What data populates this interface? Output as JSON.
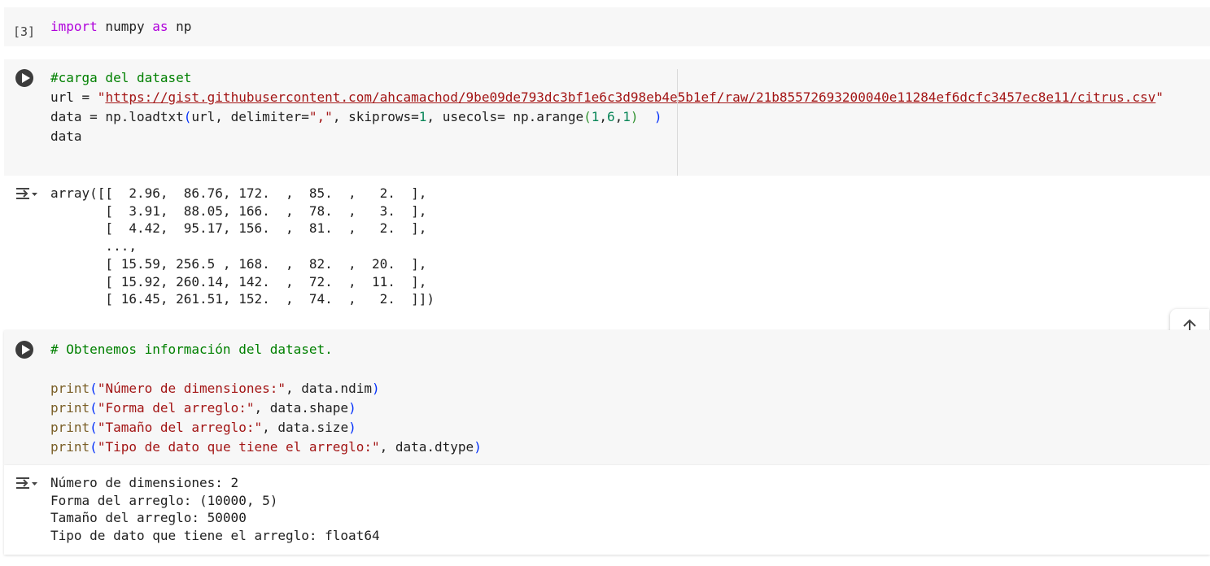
{
  "cell1": {
    "exec_count": "[3]",
    "import_kw": "import",
    "module": " numpy ",
    "as_kw": "as",
    "alias": " np"
  },
  "cell2": {
    "comment": "#carga del dataset",
    "line2_prefix": "url = ",
    "url_quote_open": "\"",
    "url": "https://gist.githubusercontent.com/ahcamachod/9be09de793dc3bf1e6c3d98eb4e5b1ef/raw/21b85572693200040e11284ef6dcfc3457ec8e11/citrus.csv",
    "url_quote_close": "\"",
    "line3_a": "data = np.loadtxt",
    "line3_paren_open": "(",
    "line3_b": "url, delimiter=",
    "line3_str": "\",\"",
    "line3_c": ", skiprows=",
    "line3_num1": "1",
    "line3_d": ", usecols= np.arange",
    "line3_inner_open": "(",
    "line3_num2": "1",
    "line3_comma1": ",",
    "line3_num3": "6",
    "line3_comma2": ",",
    "line3_num4": "1",
    "line3_inner_close": ")",
    "line3_spaces": "  ",
    "line3_paren_close": ")",
    "line4": "data"
  },
  "output2": {
    "lines": [
      "array([[  2.96,  86.76, 172.  ,  85.  ,   2.  ],",
      "       [  3.91,  88.05, 166.  ,  78.  ,   3.  ],",
      "       [  4.42,  95.17, 156.  ,  81.  ,   2.  ],",
      "       ...,",
      "       [ 15.59, 256.5 , 168.  ,  82.  ,  20.  ],",
      "       [ 15.92, 260.14, 142.  ,  72.  ,  11.  ],",
      "       [ 16.45, 261.51, 152.  ,  74.  ,   2.  ]])"
    ]
  },
  "cell3": {
    "comment": "# Obtenemos información del dataset.",
    "prints": [
      {
        "fn": "print",
        "str": "\"Número de dimensiones:\"",
        "rest": ", data.ndim"
      },
      {
        "fn": "print",
        "str": "\"Forma del arreglo:\"",
        "rest": ", data.shape"
      },
      {
        "fn": "print",
        "str": "\"Tamaño del arreglo:\"",
        "rest": ", data.size"
      },
      {
        "fn": "print",
        "str": "\"Tipo de dato que tiene el arreglo:\"",
        "rest": ", data.dtype"
      }
    ]
  },
  "output3": {
    "lines": [
      "Número de dimensiones: 2",
      "Forma del arreglo: (10000, 5)",
      "Tamaño del arreglo: 50000",
      "Tipo de dato que tiene el arreglo: float64"
    ]
  },
  "icons": {
    "run": "run-cell-icon",
    "output": "output-toggle-icon",
    "scroll": "arrow-up-icon"
  }
}
